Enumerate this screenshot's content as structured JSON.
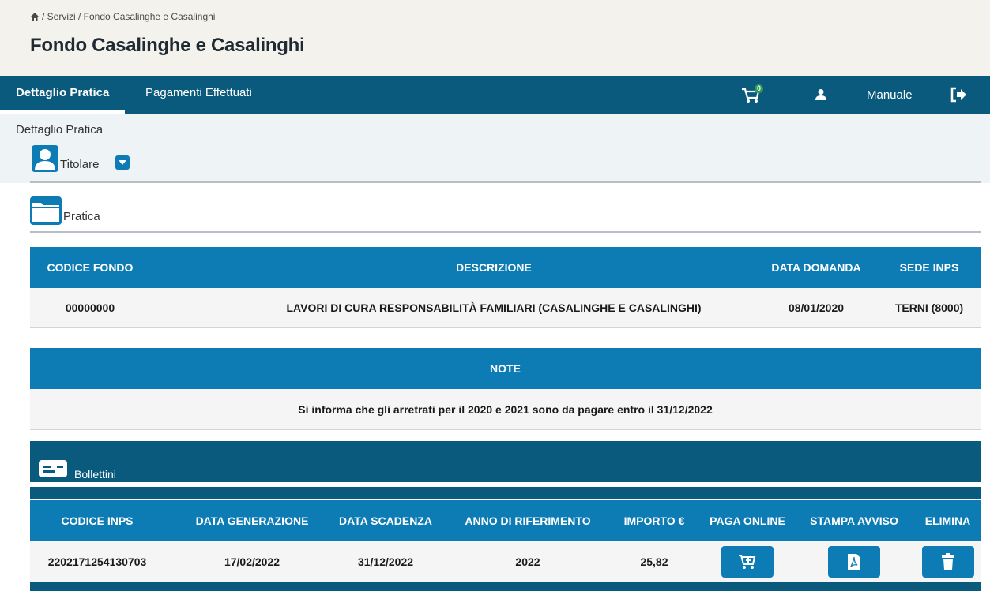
{
  "breadcrumb": {
    "text": "/ Servizi / Fondo Casalinghe e Casalinghi"
  },
  "page": {
    "title": "Fondo Casalinghe e Casalinghi"
  },
  "nav": {
    "tabs": [
      {
        "label": "Dettaglio Pratica",
        "active": true
      },
      {
        "label": "Pagamenti Effettuati",
        "active": false
      }
    ],
    "cart_count": "0",
    "manual_label": "Manuale"
  },
  "section": {
    "detail_label": "Dettaglio Pratica",
    "titolare_label": "Titolare",
    "pratica_label": "Pratica"
  },
  "pratica_table": {
    "headers": [
      "CODICE FONDO",
      "DESCRIZIONE",
      "DATA DOMANDA",
      "SEDE INPS"
    ],
    "row": [
      "00000000",
      "LAVORI DI CURA RESPONSABILITÀ FAMILIARI (CASALINGHE E CASALINGHI)",
      "08/01/2020",
      "TERNI (8000)"
    ]
  },
  "note": {
    "header": "NOTE",
    "text": "Si informa che gli arretrati per il 2020 e 2021 sono da pagare entro il 31/12/2022"
  },
  "bollettini": {
    "label": "Bollettini",
    "headers": [
      "CODICE INPS",
      "DATA GENERAZIONE",
      "DATA SCADENZA",
      "ANNO DI RIFERIMENTO",
      "IMPORTO €",
      "PAGA ONLINE",
      "STAMPA AVVISO",
      "ELIMINA"
    ],
    "row": [
      "2202171254130703",
      "17/02/2022",
      "31/12/2022",
      "2022",
      "25,82"
    ]
  },
  "colors": {
    "nav": "#0a5a7e",
    "table_header": "#0e7cb4",
    "header_bg": "#f3f2ed"
  },
  "icons": [
    "home-icon",
    "cart-icon",
    "user-icon",
    "logout-icon",
    "user-avatar-icon",
    "caret-down-icon",
    "folder-icon",
    "card-icon",
    "cart-plus-icon",
    "pdf-icon",
    "trash-icon"
  ]
}
